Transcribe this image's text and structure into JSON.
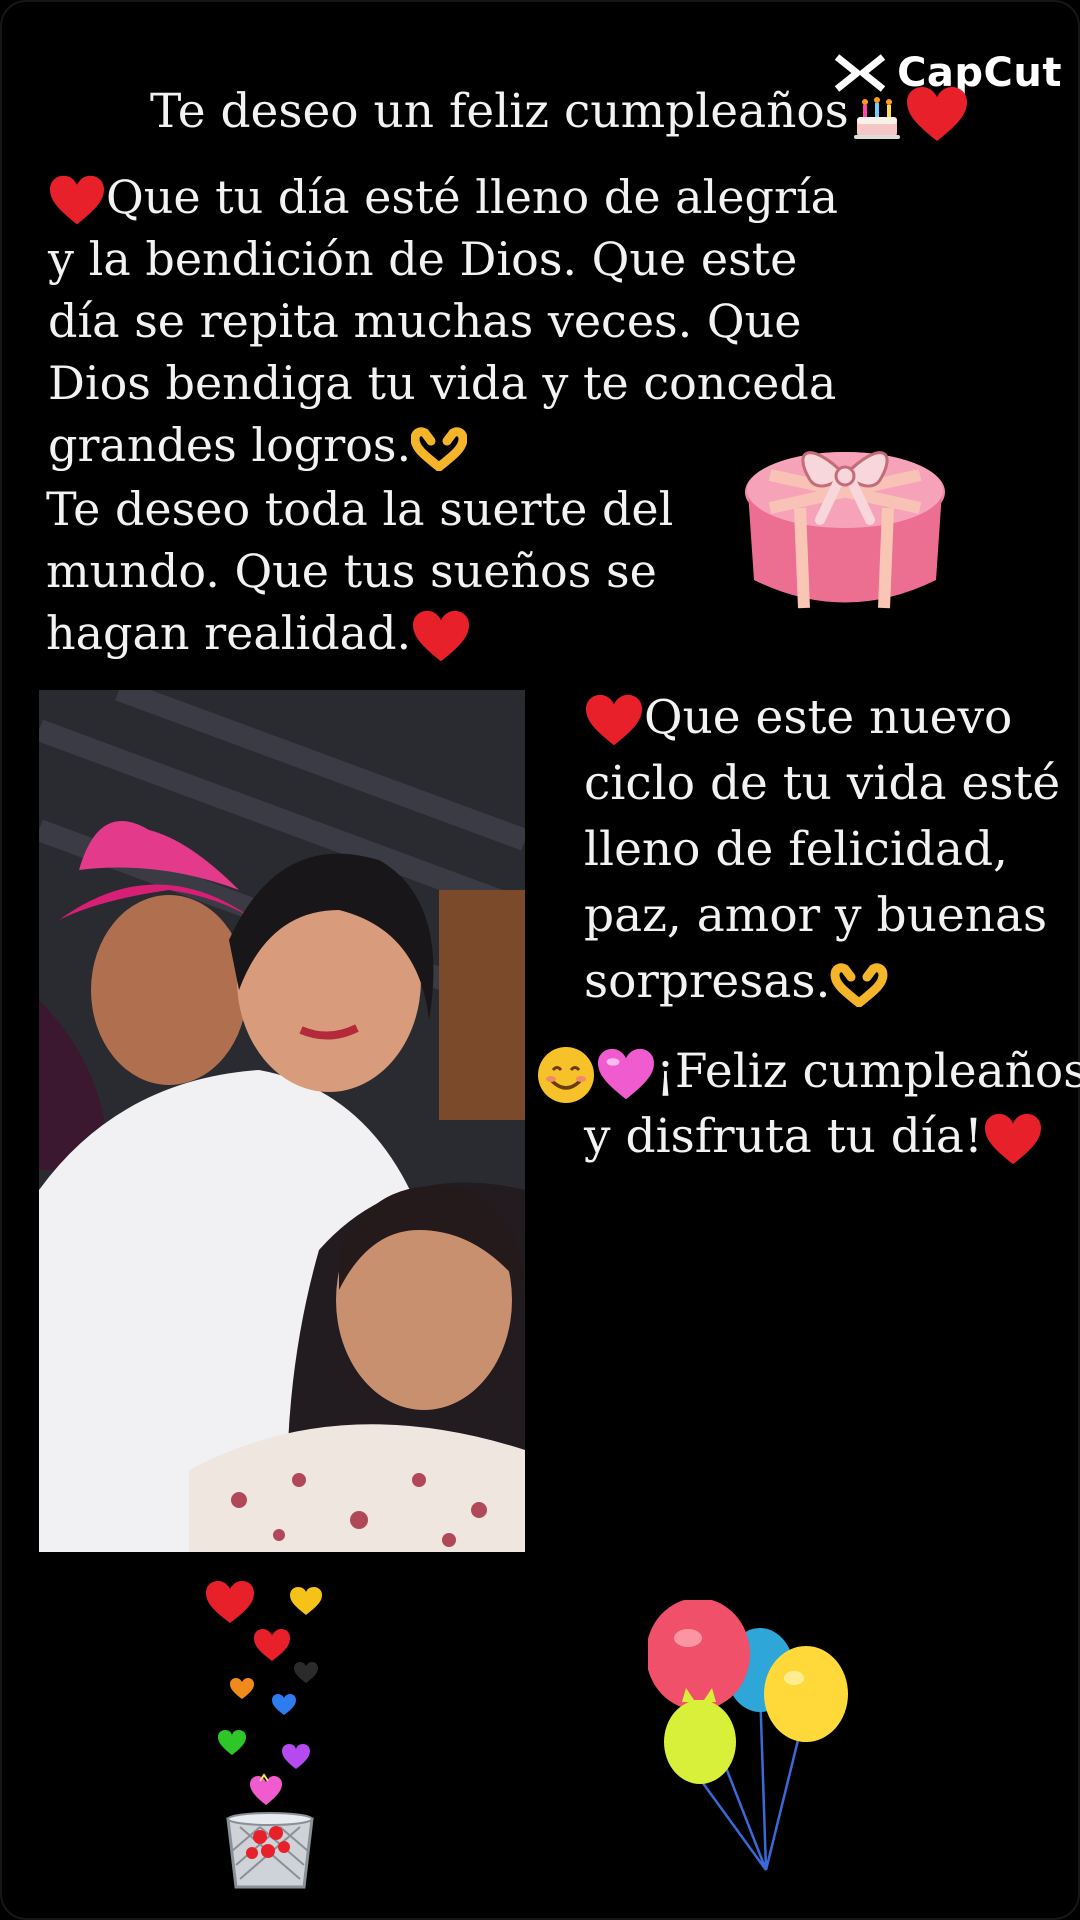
{
  "watermark": {
    "label": "CapCut",
    "icon": "capcut-logo-icon"
  },
  "title": "Te deseo un feliz cumpleaños",
  "paragraph1": {
    "lines": [
      "Que tu día esté lleno de alegría",
      "y la bendición de Dios. Que este",
      "día se repita muchas veces. Que",
      "Dios bendiga tu vida y te conceda",
      "grandes logros."
    ]
  },
  "paragraph2": {
    "lines": [
      "Te deseo toda la suerte del",
      "mundo. Que tus sueños se",
      "hagan realidad."
    ]
  },
  "paragraph3": {
    "lines": [
      "Que este nuevo",
      "ciclo de tu vida esté",
      "lleno de felicidad,",
      "paz, amor y buenas",
      "sorpresas."
    ]
  },
  "paragraph4": {
    "lines": [
      "¡Feliz cumpleaños",
      "y disfruta tu día!"
    ]
  },
  "colors": {
    "background": "#000000",
    "text": "#f2f2f2",
    "heart_red": "#e8202a",
    "gift_pink": "#ee7a9a",
    "hat_pink": "#d81f76"
  },
  "icons": {
    "heart": "red-heart-icon",
    "cake": "birthday-cake-icon",
    "heart_hands": "heart-hands-icon",
    "smile": "smiling-face-icon",
    "pink_heart": "pink-heart-icon",
    "gift": "gift-box-icon",
    "balloons": "balloons-icon",
    "hearts_basket": "hearts-basket-icon"
  }
}
